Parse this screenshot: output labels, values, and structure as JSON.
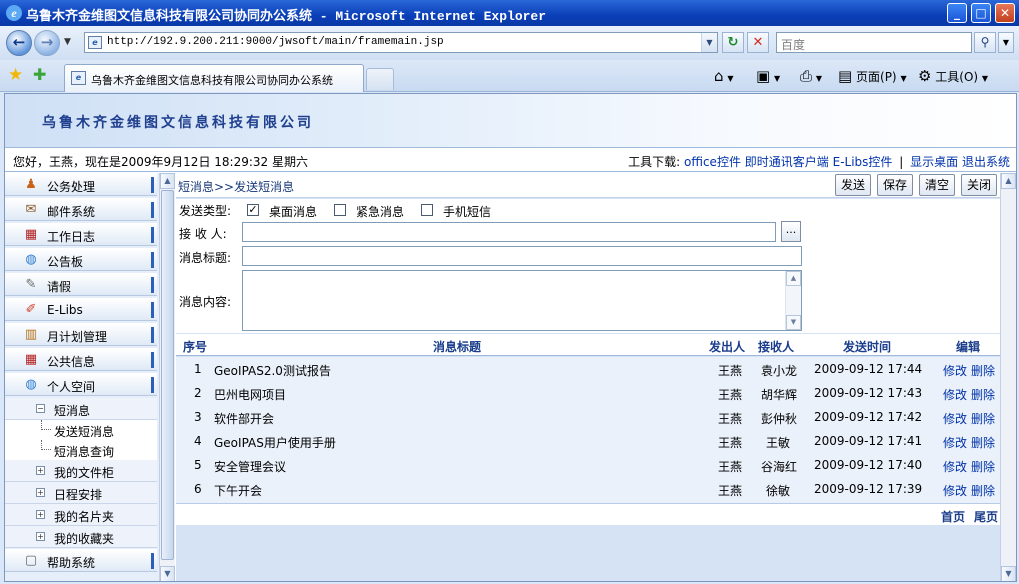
{
  "browser": {
    "window_title": "乌鲁木齐金维图文信息科技有限公司协同办公系统 - Microsoft Internet Explorer",
    "url": "http://192.9.200.211:9000/jwsoft/main/framemain.jsp",
    "search_placeholder": "百度",
    "tab_title": "乌鲁木齐金维图文信息科技有限公司协同办公系统",
    "cmd_page": "页面(P)",
    "cmd_tools": "工具(O)"
  },
  "app": {
    "company": "乌鲁木齐金维图文信息科技有限公司",
    "greeting": "您好，王燕，现在是2009年9月12日  18:29:32 星期六",
    "tools_prefix": "工具下载:",
    "tool_links": [
      "office控件",
      "即时通讯客户端",
      "E-Libs控件",
      "显示桌面",
      "退出系统"
    ]
  },
  "menu": {
    "items": [
      "公务处理",
      "邮件系统",
      "工作日志",
      "公告板",
      "请假",
      "E-Libs",
      "月计划管理",
      "公共信息",
      "个人空间"
    ],
    "sub_open": "短消息",
    "leaves": [
      "发送短消息",
      "短消息查询"
    ],
    "subs": [
      "我的文件柜",
      "日程安排",
      "我的名片夹",
      "我的收藏夹"
    ],
    "last": "帮助系统"
  },
  "content": {
    "breadcrumb": "短消息>>发送短消息",
    "buttons": {
      "send": "发送",
      "save": "保存",
      "clear": "清空",
      "close": "关闭"
    },
    "send_type_label": "发送类型:",
    "options": [
      {
        "label": "桌面消息",
        "checked": true
      },
      {
        "label": "紧急消息",
        "checked": false
      },
      {
        "label": "手机短信",
        "checked": false
      }
    ],
    "receiver_label": "接 收 人:",
    "subject_label": "消息标题:",
    "body_label": "消息内容:",
    "picker_label": "..."
  },
  "table": {
    "headers": {
      "no": "序号",
      "title": "消息标题",
      "sender": "发出人",
      "receiver": "接收人",
      "time": "发送时间",
      "edit": "编辑"
    },
    "rows": [
      {
        "no": "1",
        "title": "GeoIPAS2.0测试报告",
        "sender": "王燕",
        "receiver": "袁小龙",
        "time": "2009-09-12 17:44"
      },
      {
        "no": "2",
        "title": "巴州电网项目",
        "sender": "王燕",
        "receiver": "胡华辉",
        "time": "2009-09-12 17:43"
      },
      {
        "no": "3",
        "title": "软件部开会",
        "sender": "王燕",
        "receiver": "彭仲秋",
        "time": "2009-09-12 17:42"
      },
      {
        "no": "4",
        "title": "GeoIPAS用户使用手册",
        "sender": "王燕",
        "receiver": "王敏",
        "time": "2009-09-12 17:41"
      },
      {
        "no": "5",
        "title": "安全管理会议",
        "sender": "王燕",
        "receiver": "谷海红",
        "time": "2009-09-12 17:40"
      },
      {
        "no": "6",
        "title": "下午开会",
        "sender": "王燕",
        "receiver": "徐敏",
        "time": "2009-09-12 17:39"
      }
    ],
    "edit_label": "修改",
    "delete_label": "删除",
    "first_page": "首页",
    "last_page": "尾页"
  }
}
